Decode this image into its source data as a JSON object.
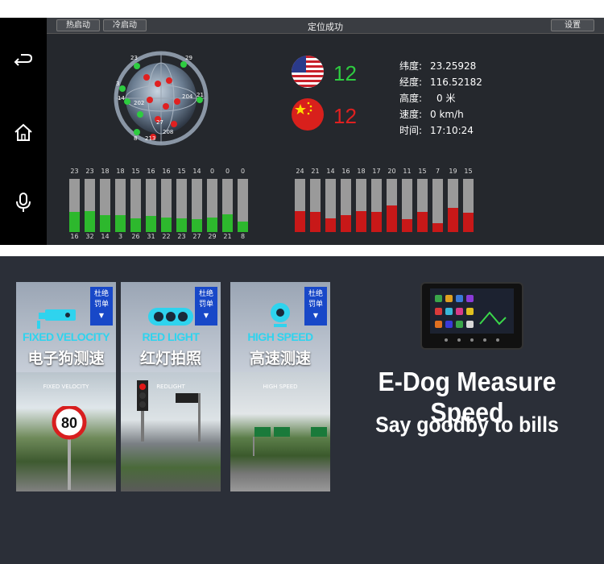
{
  "header": {
    "hot_start": "热启动",
    "cold_start": "冷启动",
    "title": "定位成功",
    "settings": "设置"
  },
  "sidebar": {
    "items": [
      {
        "icon": "back-icon",
        "glyph": "⮌"
      },
      {
        "icon": "home-icon",
        "glyph": "⌂"
      },
      {
        "icon": "microphone-icon",
        "glyph": "🎙"
      }
    ]
  },
  "satellites": {
    "gps_count": "12",
    "beidou_count": "12",
    "gps_color": "#2ecc40",
    "beidou_color": "#e02020",
    "sky_labels": [
      "23",
      "29",
      "3",
      "21",
      "8",
      "202",
      "213",
      "208",
      "204",
      "27",
      "14"
    ]
  },
  "position": {
    "latitude_label": "纬度:",
    "latitude_value": "23.25928",
    "longitude_label": "经度:",
    "longitude_value": "116.52182",
    "altitude_label": "高度:",
    "altitude_value": "0 米",
    "speed_label": "速度:",
    "speed_value": "0 km/h",
    "time_label": "时间:",
    "time_value": "17:10:24"
  },
  "gps_bars": {
    "snr": [
      "23",
      "23",
      "18",
      "18",
      "15",
      "16",
      "16",
      "15",
      "14",
      "0",
      "0",
      "0"
    ],
    "prn": [
      "16",
      "32",
      "14",
      "3",
      "26",
      "31",
      "22",
      "23",
      "27",
      "29",
      "21",
      "8"
    ],
    "fill": [
      0.38,
      0.4,
      0.32,
      0.32,
      0.26,
      0.3,
      0.28,
      0.26,
      0.24,
      0.28,
      0.34,
      0.2
    ],
    "color": "#2db82d"
  },
  "beidou_bars": {
    "snr": [
      "24",
      "21",
      "14",
      "16",
      "18",
      "17",
      "20",
      "11",
      "15",
      "7",
      "19",
      "15"
    ],
    "fill": [
      0.4,
      0.38,
      0.26,
      0.32,
      0.4,
      0.38,
      0.5,
      0.24,
      0.38,
      0.16,
      0.46,
      0.36
    ],
    "color": "#c81818"
  },
  "cards": [
    {
      "badge_line1": "杜绝",
      "badge_line2": "罚单",
      "en": "FIXED VELOCITY",
      "cn": "电子狗测速",
      "caption": "FIXED VELOCITY",
      "sign": "80"
    },
    {
      "badge_line1": "杜绝",
      "badge_line2": "罚单",
      "en": "RED LIGHT",
      "cn": "红灯拍照",
      "caption": "REDLIGHT"
    },
    {
      "badge_line1": "杜绝",
      "badge_line2": "罚单",
      "en": "HIGH SPEED",
      "cn": "高速测速",
      "caption": "HIGH SPEED"
    }
  ],
  "promo": {
    "headline": "E-Dog Measure Speed",
    "subline": "Say goodby to bills"
  }
}
